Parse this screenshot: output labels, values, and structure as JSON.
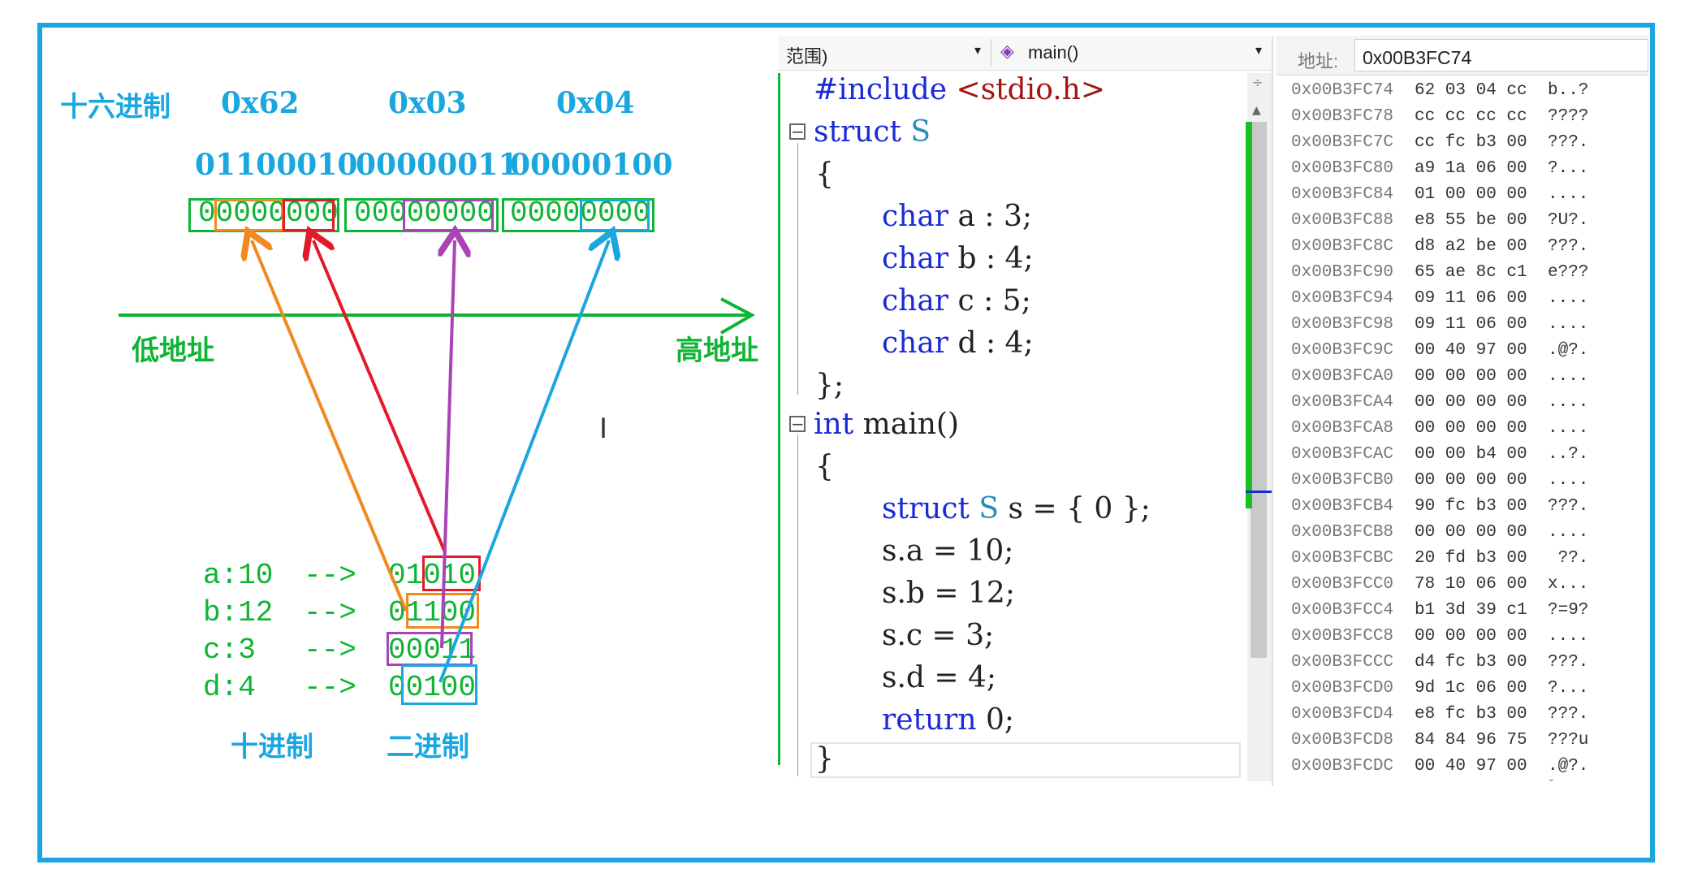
{
  "diagram": {
    "hex_label": "十六进制",
    "hex_values": [
      "0x62",
      "0x03",
      "0x04"
    ],
    "binary_bytes": [
      "01100010",
      "00000011",
      "00000100"
    ],
    "memory_bits": [
      "00000000",
      "00000000",
      "00000000"
    ],
    "low_address": "低地址",
    "high_address": "高地址",
    "assignments": [
      {
        "label": "a:10",
        "arrow": "-->",
        "bits": "01010"
      },
      {
        "label": "b:12",
        "arrow": "-->",
        "bits": "01100"
      },
      {
        "label": "c:3",
        "arrow": "-->",
        "bits": "00011"
      },
      {
        "label": "d:4",
        "arrow": "-->",
        "bits": "00100"
      }
    ],
    "decimal_label": "十进制",
    "binary_label": "二进制",
    "colors": {
      "a": "#f08a20",
      "b": "#e21b2b",
      "c": "#a943b6",
      "d": "#1ba6e0",
      "green": "#0fb434",
      "cyan": "#1aa7e0"
    }
  },
  "editor": {
    "scope_dropdown": "范围)",
    "function_dropdown": "main()",
    "lines": {
      "l1_kw": "#include",
      "l1_str": "<stdio.h>",
      "l2_kw": "struct",
      "l2_name": "S",
      "l3": "{",
      "l4_kw": "char",
      "l4_rest": "a : 3;",
      "l5_kw": "char",
      "l5_rest": "b : 4;",
      "l6_kw": "char",
      "l6_rest": "c : 5;",
      "l7_kw": "char",
      "l7_rest": "d : 4;",
      "l8": "};",
      "l9_kw": "int",
      "l9_rest": "main()",
      "l10": "{",
      "l11_kw": "struct",
      "l11_type": "S",
      "l11_rest": "s = { 0 };",
      "l12": "s.a = 10;",
      "l13": "s.b = 12;",
      "l14": "s.c = 3;",
      "l15": "s.d = 4;",
      "l16_kw": "return",
      "l16_rest": "0;",
      "l17": "}"
    }
  },
  "memory": {
    "address_label": "地址:",
    "address_value": "0x00B3FC74",
    "rows": [
      {
        "addr": "0x00B3FC74",
        "bytes": "62 03 04 cc",
        "ascii": "b..?"
      },
      {
        "addr": "0x00B3FC78",
        "bytes": "cc cc cc cc",
        "ascii": "????"
      },
      {
        "addr": "0x00B3FC7C",
        "bytes": "cc fc b3 00",
        "ascii": "???."
      },
      {
        "addr": "0x00B3FC80",
        "bytes": "a9 1a 06 00",
        "ascii": "?..."
      },
      {
        "addr": "0x00B3FC84",
        "bytes": "01 00 00 00",
        "ascii": "...."
      },
      {
        "addr": "0x00B3FC88",
        "bytes": "e8 55 be 00",
        "ascii": "?U?."
      },
      {
        "addr": "0x00B3FC8C",
        "bytes": "d8 a2 be 00",
        "ascii": "???."
      },
      {
        "addr": "0x00B3FC90",
        "bytes": "65 ae 8c c1",
        "ascii": "e???"
      },
      {
        "addr": "0x00B3FC94",
        "bytes": "09 11 06 00",
        "ascii": "...."
      },
      {
        "addr": "0x00B3FC98",
        "bytes": "09 11 06 00",
        "ascii": "...."
      },
      {
        "addr": "0x00B3FC9C",
        "bytes": "00 40 97 00",
        "ascii": ".@?."
      },
      {
        "addr": "0x00B3FCA0",
        "bytes": "00 00 00 00",
        "ascii": "...."
      },
      {
        "addr": "0x00B3FCA4",
        "bytes": "00 00 00 00",
        "ascii": "...."
      },
      {
        "addr": "0x00B3FCA8",
        "bytes": "00 00 00 00",
        "ascii": "...."
      },
      {
        "addr": "0x00B3FCAC",
        "bytes": "00 00 b4 00",
        "ascii": "..?."
      },
      {
        "addr": "0x00B3FCB0",
        "bytes": "00 00 00 00",
        "ascii": "...."
      },
      {
        "addr": "0x00B3FCB4",
        "bytes": "90 fc b3 00",
        "ascii": "???."
      },
      {
        "addr": "0x00B3FCB8",
        "bytes": "00 00 00 00",
        "ascii": "...."
      },
      {
        "addr": "0x00B3FCBC",
        "bytes": "20 fd b3 00",
        "ascii": " ??."
      },
      {
        "addr": "0x00B3FCC0",
        "bytes": "78 10 06 00",
        "ascii": "x..."
      },
      {
        "addr": "0x00B3FCC4",
        "bytes": "b1 3d 39 c1",
        "ascii": "?=9?"
      },
      {
        "addr": "0x00B3FCC8",
        "bytes": "00 00 00 00",
        "ascii": "...."
      },
      {
        "addr": "0x00B3FCCC",
        "bytes": "d4 fc b3 00",
        "ascii": "???."
      },
      {
        "addr": "0x00B3FCD0",
        "bytes": "9d 1c 06 00",
        "ascii": "?..."
      },
      {
        "addr": "0x00B3FCD4",
        "bytes": "e8 fc b3 00",
        "ascii": "???."
      },
      {
        "addr": "0x00B3FCD8",
        "bytes": "84 84 96 75",
        "ascii": "???u"
      },
      {
        "addr": "0x00B3FCDC",
        "bytes": "00 40 97 00",
        "ascii": ".@?."
      }
    ]
  }
}
